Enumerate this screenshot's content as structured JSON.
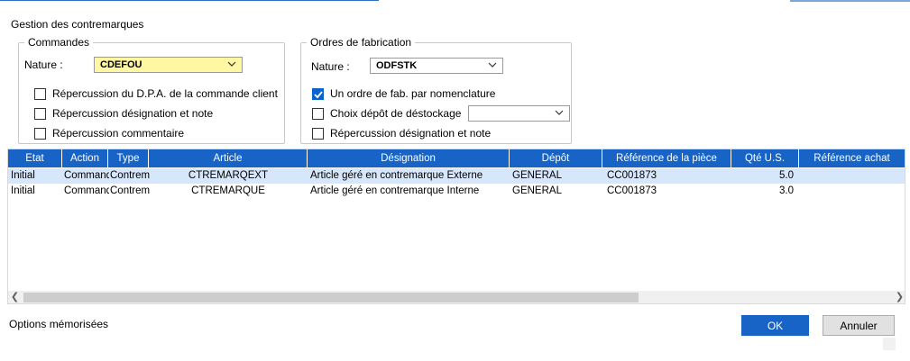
{
  "window": {
    "title": "Gestion des contremarques"
  },
  "commandes": {
    "legend": "Commandes",
    "nature_label": "Nature :",
    "nature_value": "CDEFOU",
    "options": [
      {
        "label": "Répercussion du D.P.A. de la commande client",
        "checked": false
      },
      {
        "label": "Répercussion désignation et note",
        "checked": false
      },
      {
        "label": "Répercussion commentaire",
        "checked": false
      }
    ]
  },
  "ordres": {
    "legend": "Ordres de fabrication",
    "nature_label": "Nature :",
    "nature_value": "ODFSTK",
    "options": [
      {
        "label": "Un ordre de fab. par nomenclature",
        "checked": true
      },
      {
        "label": "Choix dépôt de déstockage",
        "checked": false,
        "select_value": ""
      },
      {
        "label": "Répercussion désignation et note",
        "checked": false
      }
    ]
  },
  "grid": {
    "columns": [
      "Etat",
      "Action",
      "Type",
      "Article",
      "Désignation",
      "Dépôt",
      "Référence de la pièce",
      "Qté U.S.",
      "Référence achat"
    ],
    "rows": [
      {
        "etat": "Initial",
        "action": "Command",
        "type": "Contrem",
        "article": "CTREMARQEXT",
        "designation": "Article géré en contremarque Externe",
        "depot": "GENERAL",
        "reference_piece": "CC001873",
        "qte": "5.0",
        "reference_achat": "",
        "selected": true
      },
      {
        "etat": "Initial",
        "action": "Command",
        "type": "Contrem",
        "article": "CTREMARQUE",
        "designation": "Article géré en contremarque Interne",
        "depot": "GENERAL",
        "reference_piece": "CC001873",
        "qte": "3.0",
        "reference_achat": "",
        "selected": false
      }
    ]
  },
  "footer": {
    "options_label": "Options mémorisées",
    "ok_label": "OK",
    "cancel_label": "Annuler"
  },
  "colors": {
    "accent": "#1764c6",
    "selected_row": "#d6e7fb",
    "nature_highlight": "#fff7a1"
  },
  "icons": {
    "dropdown": "chevron-down-icon",
    "check": "check-icon",
    "scroll_left": "chevron-left-icon",
    "scroll_right": "chevron-right-icon"
  }
}
